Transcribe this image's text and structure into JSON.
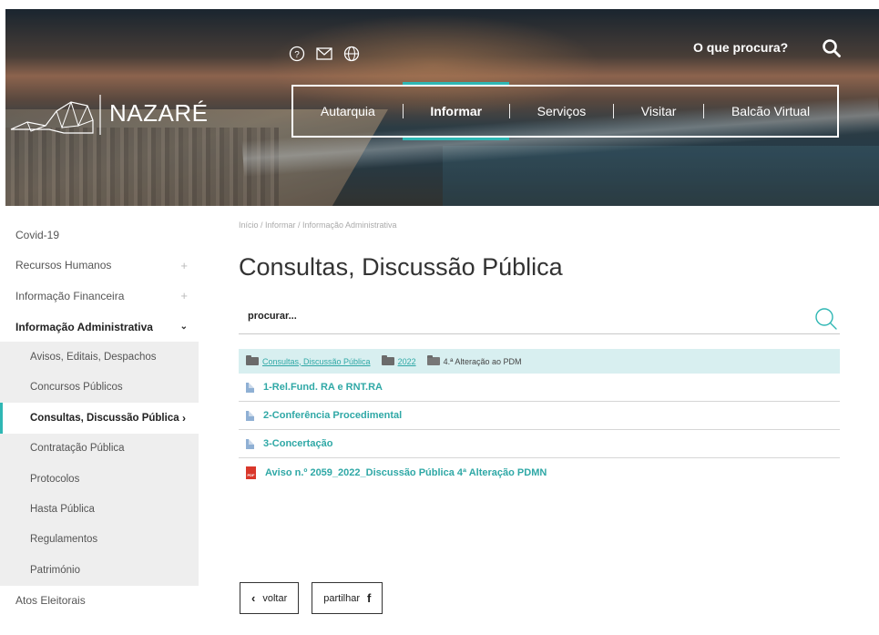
{
  "header": {
    "brand": "NAZARÉ",
    "search_label": "O que procura?",
    "icons": [
      "help-circle-icon",
      "mail-icon",
      "globe-icon",
      "search-icon"
    ],
    "nav": [
      {
        "label": "Autarquia",
        "active": false
      },
      {
        "label": "Informar",
        "active": true
      },
      {
        "label": "Serviços",
        "active": false
      },
      {
        "label": "Visitar",
        "active": false
      },
      {
        "label": "Balcão Virtual",
        "active": false
      }
    ],
    "accent_color": "#2fb7b4"
  },
  "sidebar": {
    "items": [
      {
        "label": "Covid-19"
      },
      {
        "label": "Recursos Humanos",
        "expand": "+"
      },
      {
        "label": "Informação Financeira",
        "expand": "+"
      },
      {
        "label": "Informação Administrativa",
        "expand": "⌄"
      }
    ],
    "subitems": [
      {
        "label": "Avisos, Editais, Despachos"
      },
      {
        "label": "Concursos Públicos"
      },
      {
        "label": "Consultas, Discussão Pública",
        "marker": "›"
      },
      {
        "label": "Contratação Pública"
      },
      {
        "label": "Protocolos"
      },
      {
        "label": "Hasta Pública"
      },
      {
        "label": "Regulamentos"
      },
      {
        "label": "Património"
      }
    ],
    "after": [
      {
        "label": "Atos Eleitorais"
      }
    ]
  },
  "main": {
    "breadcrumb": "Início / Informar / Informação Administrativa",
    "title": "Consultas, Discussão Pública",
    "search_placeholder": "procurar...",
    "path": {
      "folder1": "Consultas, Discussão Pública",
      "folder2": "2022",
      "folder3": "4.ª Alteração ao PDM"
    },
    "files": [
      {
        "name": "1-Rel.Fund. RA e RNT.RA",
        "type": "doc"
      },
      {
        "name": "2-Conferência Procedimental",
        "type": "doc"
      },
      {
        "name": "3-Concertação",
        "type": "doc"
      },
      {
        "name": "Aviso n.º 2059_2022_Discussão Pública 4ª Alteração PDMN",
        "type": "pdf",
        "badge": "PDF"
      }
    ],
    "back_label": "voltar",
    "back_icon": "‹",
    "share_label": "partilhar",
    "share_icon": "f"
  }
}
